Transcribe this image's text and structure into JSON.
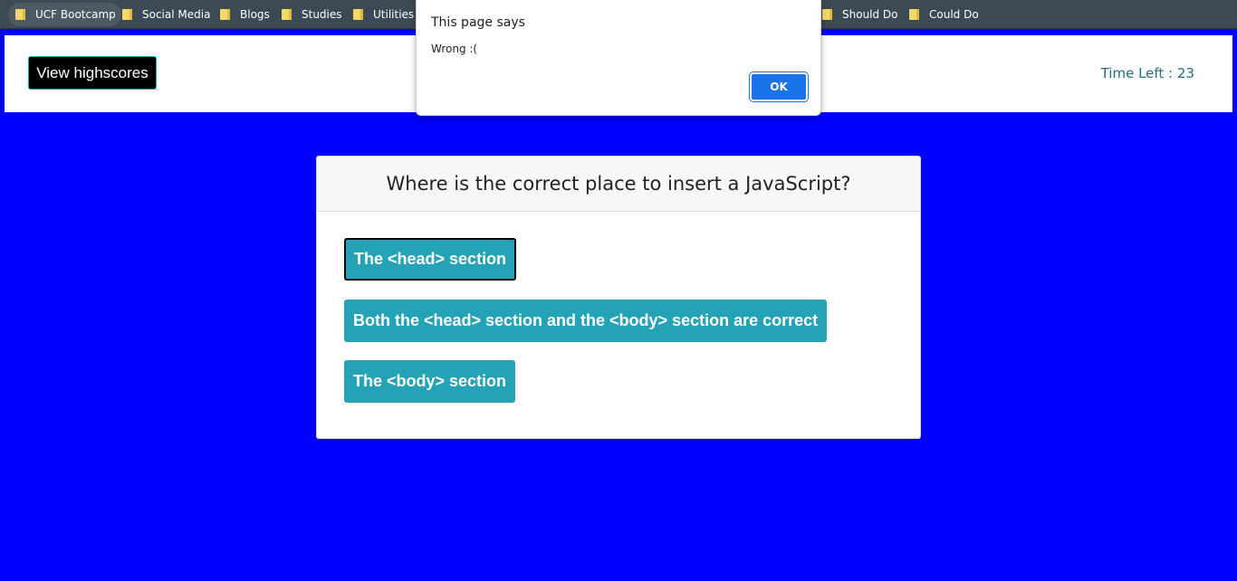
{
  "bookmarks": [
    {
      "label": "UCF Bootcamp",
      "icon": "folder-icon"
    },
    {
      "label": "Social Media",
      "icon": "folder-icon"
    },
    {
      "label": "Blogs",
      "icon": "folder-icon"
    },
    {
      "label": "Studies",
      "icon": "folder-icon"
    },
    {
      "label": "Utilities",
      "icon": "folder-icon"
    },
    {
      "label": "Should Do",
      "icon": "folder-icon"
    },
    {
      "label": "Could Do",
      "icon": "folder-icon"
    }
  ],
  "header": {
    "highscores_label": "View highscores",
    "time_left_label": "Time Left :",
    "time_left_value": "23"
  },
  "quiz": {
    "question": "Where is the correct place to insert a JavaScript?",
    "answers": [
      "The <head> section",
      "Both the <head> section and the <body> section are correct",
      "The <body> section"
    ]
  },
  "dialog": {
    "title": "This page says",
    "message": "Wrong :(",
    "ok_label": "OK"
  },
  "colors": {
    "page_background": "#0000ff",
    "answer_button": "#25a3b6",
    "dialog_accent": "#1a73e8"
  }
}
